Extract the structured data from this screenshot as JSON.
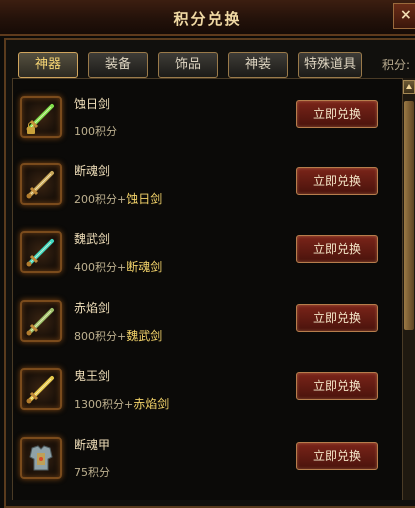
{
  "window": {
    "title": "积分兑换",
    "close_label": "×"
  },
  "tabs": [
    {
      "label": "神器",
      "active": true
    },
    {
      "label": "装备",
      "active": false
    },
    {
      "label": "饰品",
      "active": false
    },
    {
      "label": "神装",
      "active": false
    },
    {
      "label": "特殊道具",
      "active": false
    }
  ],
  "points_label": "积分:",
  "exchange_button_label": "立即兑换",
  "items": [
    {
      "name": "蚀日剑",
      "cost": "100积分",
      "requires": "",
      "icon": "sword-icon",
      "locked": true,
      "accent": "#7fdf4a"
    },
    {
      "name": "断魂剑",
      "cost": "200积分+",
      "requires": "蚀日剑",
      "icon": "sword-icon",
      "locked": false,
      "accent": "#c9a85a"
    },
    {
      "name": "魏武剑",
      "cost": "400积分+",
      "requires": "断魂剑",
      "icon": "sword-icon",
      "locked": false,
      "accent": "#3fd7c0"
    },
    {
      "name": "赤焰剑",
      "cost": "800积分+",
      "requires": "魏武剑",
      "icon": "sword-icon",
      "locked": false,
      "accent": "#9ec16a"
    },
    {
      "name": "鬼王剑",
      "cost": "1300积分+",
      "requires": "赤焰剑",
      "icon": "sword-icon",
      "locked": false,
      "accent": "#e6c84a"
    },
    {
      "name": "断魂甲",
      "cost": "75积分",
      "requires": "",
      "icon": "armor-icon",
      "locked": false,
      "accent": "#8fa2a8"
    }
  ]
}
